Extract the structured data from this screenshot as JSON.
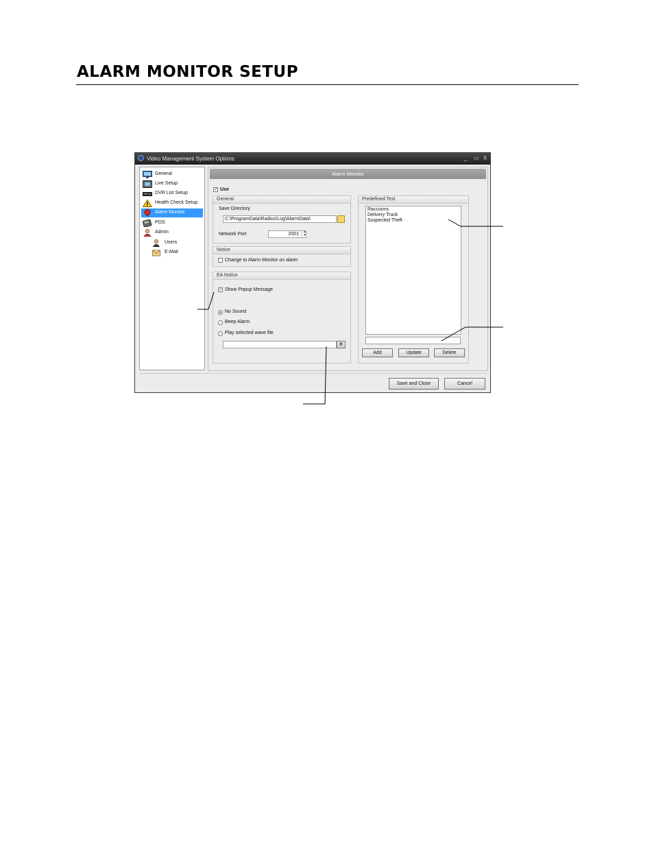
{
  "page": {
    "title": "ALARM MONITOR SETUP"
  },
  "window": {
    "title": "Video Management System Options",
    "controls": {
      "minimize": "_",
      "maximize": "▭",
      "close": "X"
    }
  },
  "sidebar": {
    "items": [
      {
        "label": "General",
        "icon": "monitor-icon"
      },
      {
        "label": "Live Setup",
        "icon": "film-icon"
      },
      {
        "label": "DVR List Setup",
        "icon": "dvr-icon"
      },
      {
        "label": "Health Check Setup",
        "icon": "warning-icon"
      },
      {
        "label": "Alarm Monitor",
        "icon": "alarm-icon",
        "selected": true
      },
      {
        "label": "POS",
        "icon": "pos-terminal-icon"
      },
      {
        "label": "Admin",
        "icon": "admin-user-icon"
      },
      {
        "label": "Users",
        "icon": "user-icon"
      },
      {
        "label": "E-Mail",
        "icon": "envelope-icon"
      }
    ]
  },
  "panel": {
    "header": "Alarm Monitor",
    "use": {
      "label": "Use",
      "checked": true
    },
    "general": {
      "title": "General",
      "save_directory_label": "Save Directory",
      "save_directory_value": "C:\\ProgramData\\Radius\\Log\\AlarmData\\",
      "network_port_label": "Network Port",
      "network_port_value": "2001"
    },
    "notice": {
      "title": "Notice",
      "change_label": "Change to Alarm Monitor on alarm",
      "checked": false
    },
    "ea_notice": {
      "title": "EA Notice",
      "popup_label": "Show Popup Message",
      "popup_checked": true,
      "radio_options": [
        "No Sound",
        "Beep Alarm",
        "Play selected wave file"
      ],
      "selected_option": "No Sound",
      "wave_file_value": ""
    },
    "predefined_text": {
      "title": "Predefined Text",
      "items": [
        "Raccoons",
        "Delivery Truck",
        "Suspected Theft"
      ],
      "input_value": "",
      "buttons": {
        "add": "Add",
        "update": "Update",
        "delete": "Delete"
      }
    }
  },
  "footer": {
    "save_close": "Save and Close",
    "cancel": "Cancel"
  },
  "colors": {
    "selection": "#3399ff",
    "titlebar": "#2a2a2a",
    "panel_header": "#9a9a9a"
  }
}
